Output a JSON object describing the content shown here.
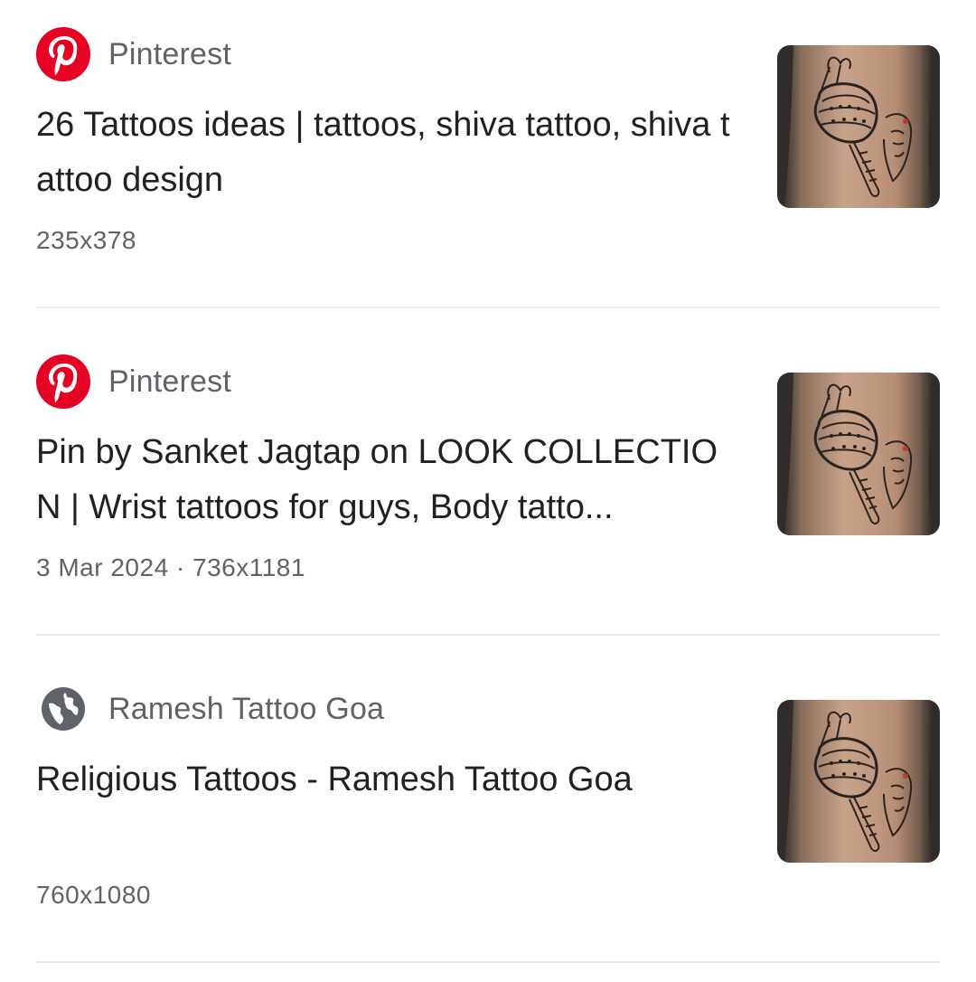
{
  "results": [
    {
      "source": "Pinterest",
      "icon": "pinterest-icon",
      "title": "26 Tattoos ideas | tattoos, shiva tattoo, shiva tattoo design",
      "meta": "235x378"
    },
    {
      "source": "Pinterest",
      "icon": "pinterest-icon",
      "title": "Pin by Sanket Jagtap on LOOK COLLECTION | Wrist tattoos for guys, Body tatto...",
      "meta": "3 Mar 2024 · 736x1181"
    },
    {
      "source": "Ramesh Tattoo Goa",
      "icon": "globe-icon",
      "title": "Religious Tattoos - Ramesh Tattoo Goa",
      "meta": "760x1080"
    }
  ],
  "colors": {
    "pinterest_red": "#e60023",
    "globe_gray": "#5f6368",
    "title_text": "#202124",
    "secondary_text": "#5f6368",
    "divider": "#e8eaed"
  },
  "thumbnail_icon": "mace-tattoo-image"
}
